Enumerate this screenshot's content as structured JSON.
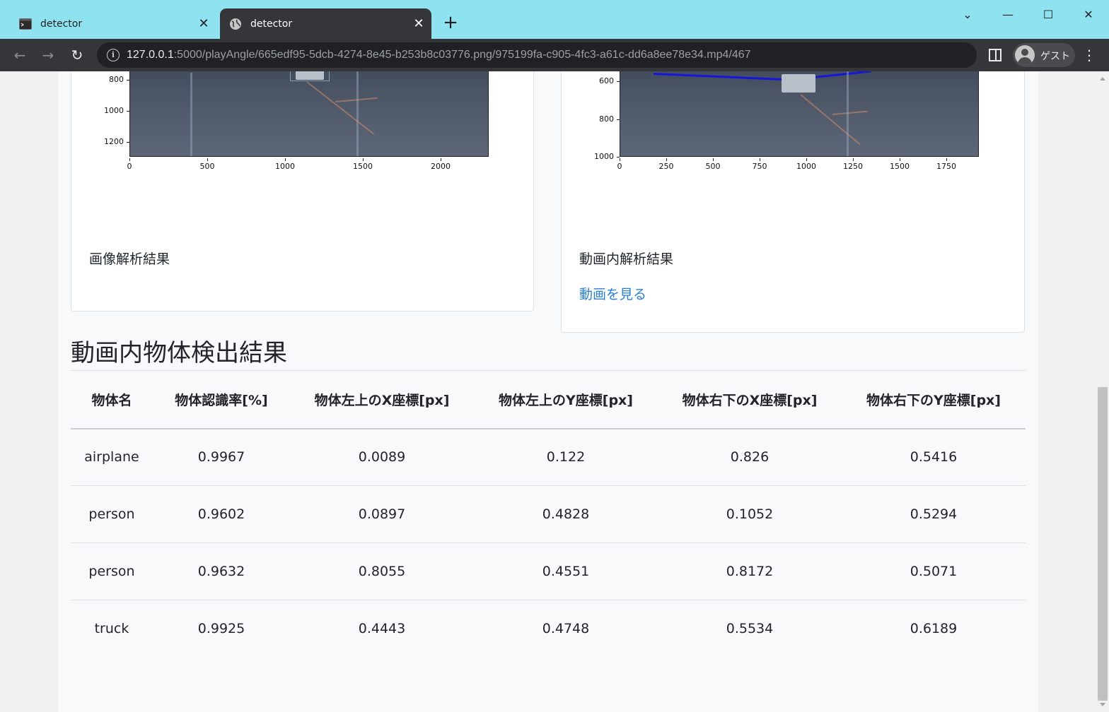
{
  "browser": {
    "tabs": [
      {
        "title": "detector",
        "icon": "terminal-icon",
        "active": false
      },
      {
        "title": "detector",
        "icon": "globe-icon",
        "active": true
      }
    ],
    "new_tab_symbol": "+",
    "close_symbol": "✕",
    "url_host": "127.0.0.1",
    "url_rest": ":5000/playAngle/665edf95-5dcb-4274-8e45-b253b8c03776.png/975199fa-c905-4fc3-a61c-dd6a8ee78e34.mp4/467",
    "profile_label": "ゲスト",
    "window_controls": {
      "tab_search": "⌄",
      "minimize": "—",
      "maximize": "☐",
      "close": "✕"
    },
    "nav": {
      "back": "←",
      "forward": "→",
      "reload": "↻",
      "info": "i",
      "menu": "⋮"
    }
  },
  "image_card": {
    "caption": "画像解析結果",
    "plot": {
      "yticks": [
        "800",
        "1000",
        "1200"
      ],
      "xticks": [
        "0",
        "500",
        "1000",
        "1500",
        "2000"
      ]
    }
  },
  "video_card": {
    "caption": "動画内解析結果",
    "link": "動画を見る",
    "plot": {
      "yticks": [
        "600",
        "800",
        "1000"
      ],
      "xticks": [
        "0",
        "250",
        "500",
        "750",
        "1000",
        "1250",
        "1500",
        "1750"
      ]
    }
  },
  "results": {
    "title": "動画内物体検出結果",
    "columns": [
      "物体名",
      "物体認識率[%]",
      "物体左上のX座標[px]",
      "物体左上のY座標[px]",
      "物体右下のX座標[px]",
      "物体右下のY座標[px]"
    ],
    "rows": [
      [
        "airplane",
        "0.9967",
        "0.0089",
        "0.122",
        "0.826",
        "0.5416"
      ],
      [
        "person",
        "0.9602",
        "0.0897",
        "0.4828",
        "0.1052",
        "0.5294"
      ],
      [
        "person",
        "0.9632",
        "0.8055",
        "0.4551",
        "0.8172",
        "0.5071"
      ],
      [
        "truck",
        "0.9925",
        "0.4443",
        "0.4748",
        "0.5534",
        "0.6189"
      ]
    ]
  },
  "colors": {
    "tabstrip": "#8fe3f1",
    "toolbar": "#35363a",
    "link": "#2a7fd4",
    "detection_line": "#1616d8"
  }
}
